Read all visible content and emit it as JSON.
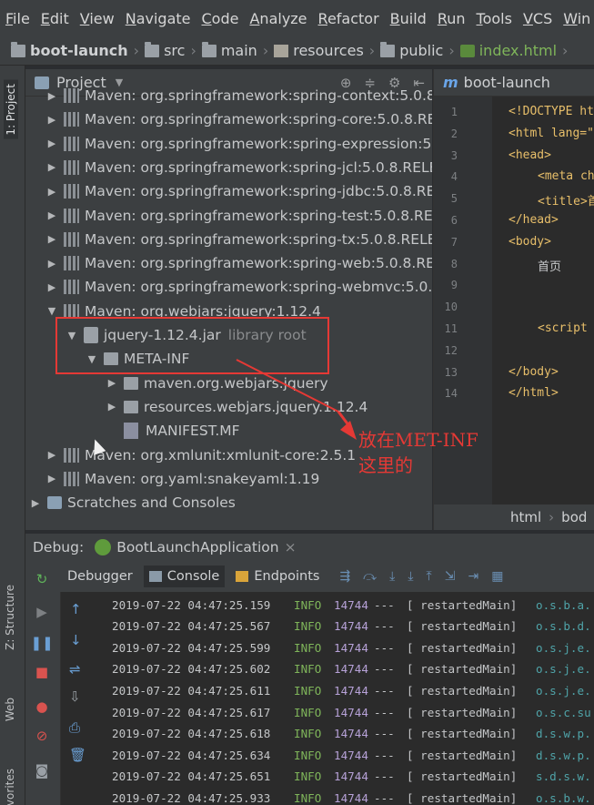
{
  "menu": [
    "File",
    "Edit",
    "View",
    "Navigate",
    "Code",
    "Analyze",
    "Refactor",
    "Build",
    "Run",
    "Tools",
    "VCS",
    "Win"
  ],
  "breadcrumb": [
    "boot-launch",
    "src",
    "main",
    "resources",
    "public",
    "index.html"
  ],
  "left_strip_tabs": [
    "1: Project",
    "Z: Structure",
    "Web",
    "vorites"
  ],
  "project_panel": {
    "title": "Project",
    "tree": [
      {
        "label": "Maven: org.springframework:spring-context:5.0.8.RE",
        "hint": "",
        "indent": 0,
        "arrow": "▶",
        "icon": "lib"
      },
      {
        "label": "Maven: org.springframework:spring-core:5.0.8.RELEA",
        "hint": "",
        "indent": 0,
        "arrow": "▶",
        "icon": "lib"
      },
      {
        "label": "Maven: org.springframework:spring-expression:5.0.8",
        "hint": "",
        "indent": 0,
        "arrow": "▶",
        "icon": "lib"
      },
      {
        "label": "Maven: org.springframework:spring-jcl:5.0.8.RELEAS",
        "hint": "",
        "indent": 0,
        "arrow": "▶",
        "icon": "lib"
      },
      {
        "label": "Maven: org.springframework:spring-jdbc:5.0.8.RELEA",
        "hint": "",
        "indent": 0,
        "arrow": "▶",
        "icon": "lib"
      },
      {
        "label": "Maven: org.springframework:spring-test:5.0.8.RELEA",
        "hint": "",
        "indent": 0,
        "arrow": "▶",
        "icon": "lib"
      },
      {
        "label": "Maven: org.springframework:spring-tx:5.0.8.RELEAS",
        "hint": "",
        "indent": 0,
        "arrow": "▶",
        "icon": "lib"
      },
      {
        "label": "Maven: org.springframework:spring-web:5.0.8.RELEA",
        "hint": "",
        "indent": 0,
        "arrow": "▶",
        "icon": "lib"
      },
      {
        "label": "Maven: org.springframework:spring-webmvc:5.0.8.R",
        "hint": "",
        "indent": 0,
        "arrow": "▶",
        "icon": "lib"
      },
      {
        "label": "Maven: org.webjars:jquery:1.12.4",
        "hint": "",
        "indent": 0,
        "arrow": "▼",
        "icon": "lib"
      },
      {
        "label": "jquery-1.12.4.jar",
        "hint": "library root",
        "indent": 1,
        "arrow": "▼",
        "icon": "jar"
      },
      {
        "label": "META-INF",
        "hint": "",
        "indent": 2,
        "arrow": "▼",
        "icon": "pkg"
      },
      {
        "label": "maven.org.webjars.jquery",
        "hint": "",
        "indent": 3,
        "arrow": "▶",
        "icon": "pkg"
      },
      {
        "label": "resources.webjars.jquery.1.12.4",
        "hint": "",
        "indent": 3,
        "arrow": "▶",
        "icon": "pkg"
      },
      {
        "label": "MANIFEST.MF",
        "hint": "",
        "indent": 3,
        "arrow": "",
        "icon": "mf"
      },
      {
        "label": "Maven: org.xmlunit:xmlunit-core:2.5.1",
        "hint": "",
        "indent": 0,
        "arrow": "▶",
        "icon": "lib"
      },
      {
        "label": "Maven: org.yaml:snakeyaml:1.19",
        "hint": "",
        "indent": 0,
        "arrow": "▶",
        "icon": "lib"
      },
      {
        "label": "Scratches and Consoles",
        "hint": "",
        "indent": -1,
        "arrow": "▶",
        "icon": "scratch"
      }
    ]
  },
  "editor": {
    "tab_label": "boot-launch",
    "line_numbers": [
      "1",
      "2",
      "3",
      "4",
      "5",
      "6",
      "7",
      "8",
      "9",
      "10",
      "11",
      "12",
      "13",
      "14"
    ],
    "lines": [
      "<!DOCTYPE ht",
      "<html lang=\"",
      "<head>",
      "<meta ch",
      "<title>首",
      "</head>",
      "<body>",
      "首页",
      "",
      "",
      "<script",
      "",
      "</body>",
      "</html>"
    ],
    "crumbs": [
      "html",
      "bod"
    ]
  },
  "debug": {
    "label": "Debug:",
    "app_name": "BootLaunchApplication",
    "tabs": [
      "Debugger",
      "Console",
      "Endpoints"
    ],
    "log": [
      {
        "ts": "2019-07-22 04:47:25.159",
        "level": "INFO",
        "pid": "14744",
        "dash": "---",
        "thread": "[  restartedMain]",
        "cls": "o.s.b.a."
      },
      {
        "ts": "2019-07-22 04:47:25.567",
        "level": "INFO",
        "pid": "14744",
        "dash": "---",
        "thread": "[  restartedMain]",
        "cls": "o.s.b.d."
      },
      {
        "ts": "2019-07-22 04:47:25.599",
        "level": "INFO",
        "pid": "14744",
        "dash": "---",
        "thread": "[  restartedMain]",
        "cls": "o.s.j.e."
      },
      {
        "ts": "2019-07-22 04:47:25.602",
        "level": "INFO",
        "pid": "14744",
        "dash": "---",
        "thread": "[  restartedMain]",
        "cls": "o.s.j.e."
      },
      {
        "ts": "2019-07-22 04:47:25.611",
        "level": "INFO",
        "pid": "14744",
        "dash": "---",
        "thread": "[  restartedMain]",
        "cls": "o.s.j.e."
      },
      {
        "ts": "2019-07-22 04:47:25.617",
        "level": "INFO",
        "pid": "14744",
        "dash": "---",
        "thread": "[  restartedMain]",
        "cls": "o.s.c.su"
      },
      {
        "ts": "2019-07-22 04:47:25.618",
        "level": "INFO",
        "pid": "14744",
        "dash": "---",
        "thread": "[  restartedMain]",
        "cls": "d.s.w.p."
      },
      {
        "ts": "2019-07-22 04:47:25.634",
        "level": "INFO",
        "pid": "14744",
        "dash": "---",
        "thread": "[  restartedMain]",
        "cls": "d.s.w.p."
      },
      {
        "ts": "2019-07-22 04:47:25.651",
        "level": "INFO",
        "pid": "14744",
        "dash": "---",
        "thread": "[  restartedMain]",
        "cls": "s.d.s.w."
      },
      {
        "ts": "2019-07-22 04:47:25.933",
        "level": "INFO",
        "pid": "14744",
        "dash": "---",
        "thread": "[  restartedMain]",
        "cls": "o.s.b.w."
      }
    ]
  },
  "annotation": {
    "line1": "放在MET-INF",
    "line2": "这里的"
  },
  "colors": {
    "annotation_red": "#e53935",
    "log_info_green": "#7fb55a",
    "log_class_teal": "#4fa3a8",
    "active_crumb_green": "#7fb55a"
  }
}
